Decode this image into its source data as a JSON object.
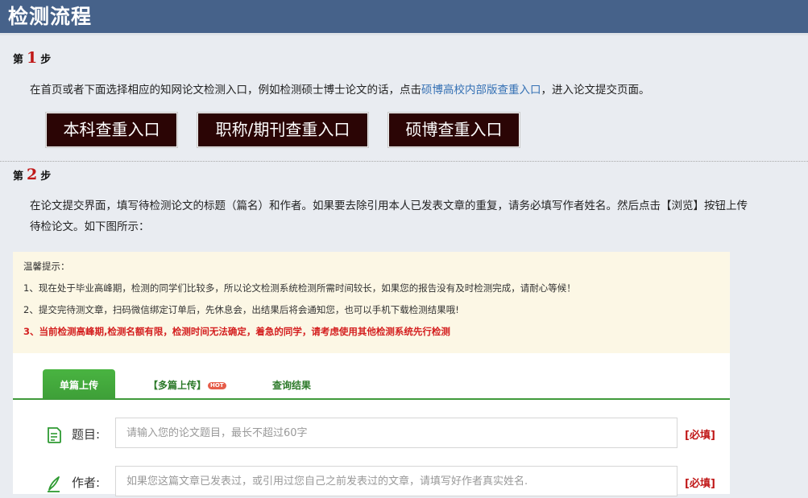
{
  "header": {
    "title": "检测流程"
  },
  "step1": {
    "prefix": "第",
    "number": "1",
    "suffix": "步",
    "desc_before": "在首页或者下面选择相应的知网论文检测入口，例如检测硕士博士论文的话，点击",
    "desc_link": "硕博高校内部版查重入口",
    "desc_after": "，进入论文提交页面。",
    "buttons": [
      "本科查重入口",
      "职称/期刊查重入口",
      "硕博查重入口"
    ]
  },
  "step2": {
    "prefix": "第",
    "number": "2",
    "suffix": "步",
    "desc_line1": "在论文提交界面，填写待检测论文的标题（篇名）和作者。如果要去除引用本人已发表文章的重复，请务必填写作者姓名。然后点击【浏览】按钮上传",
    "desc_line2": "待检论文。如下图所示："
  },
  "notice": {
    "title": "温馨提示：",
    "line1": "1、现在处于毕业高峰期，检测的同学们比较多，所以论文检测系统检测所需时间较长，如果您的报告没有及时检测完成，请耐心等候！",
    "line2": "2、提交完待测文章，扫码微信绑定订单后，先休息会，出结果后将会通知您，也可以手机下载检测结果哦!",
    "line3": "3、当前检测高峰期,检测名额有限，检测时间无法确定，着急的同学，请考虑使用其他检测系统先行检测"
  },
  "tabs": {
    "single": "单篇上传",
    "multi": "【多篇上传】",
    "hot": "HOT",
    "results": "查询结果"
  },
  "form": {
    "title_label": "题目:",
    "title_placeholder": "请输入您的论文题目，最长不超过60字",
    "author_label": "作者:",
    "author_placeholder": "如果您这篇文章已发表过，或引用过您自己之前发表过的文章，请填写好作者真实姓名.",
    "required": "[必填]"
  },
  "colors": {
    "header_bg": "#46628a",
    "accent_red": "#c01818",
    "link_blue": "#3470b4",
    "button_bg": "#2b0505",
    "tab_green": "#3f9a3b",
    "notice_bg": "#fcf7e5"
  }
}
